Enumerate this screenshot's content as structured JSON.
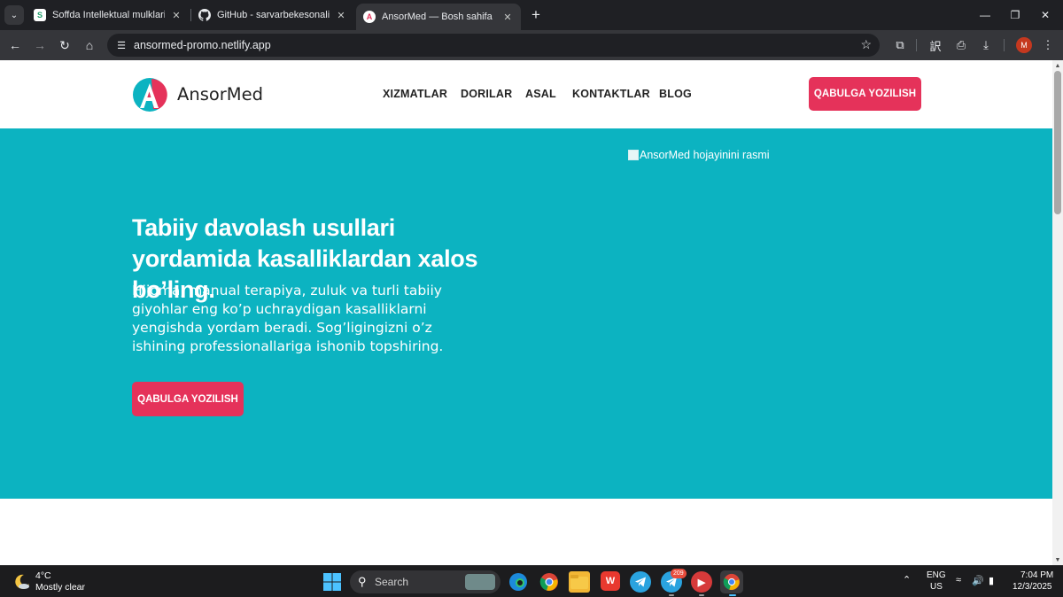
{
  "browser": {
    "tabs": [
      {
        "title": "Soffda Intellektual mulklaringiz",
        "favicon": "soffda-icon"
      },
      {
        "title": "GitHub - sarvarbekesonaliyev/A",
        "favicon": "github-icon"
      },
      {
        "title": "AnsorMed — Bosh sahifa",
        "favicon": "ansormed-icon",
        "active": true
      }
    ],
    "url": "ansormed-promo.netlify.app",
    "profile_initial": "M"
  },
  "site": {
    "brand": "AnsorMed",
    "nav": [
      "XIZMATLAR",
      "DORILAR",
      "ASAL",
      "KONTAKTLAR",
      "BLOG"
    ],
    "cta_label": "QABULGA YOZILISH",
    "accent_color": "#e5325a",
    "hero_color": "#0cb3c1",
    "hero": {
      "image_alt": "AnsorMed hojayinini rasmi",
      "title": "Tabiiy davolash usullari yordamida kasalliklardan xalos bo’ling.",
      "text": "Hijoma, manual terapiya, zuluk va turli tabiiy giyohlar eng ko’p uchraydigan kasalliklarni yengishda yordam beradi. Sog’ligingizni o’z ishining professionallariga ishonib topshiring.",
      "cta_label": "QABULGA YOZILISH"
    }
  },
  "taskbar": {
    "weather_temp": "4°C",
    "weather_desc": "Mostly clear",
    "search_label": "Search",
    "telegram_badge": "209",
    "lang_line1": "ENG",
    "lang_line2": "US",
    "time": "7:04 PM",
    "date": "12/3/2025"
  }
}
